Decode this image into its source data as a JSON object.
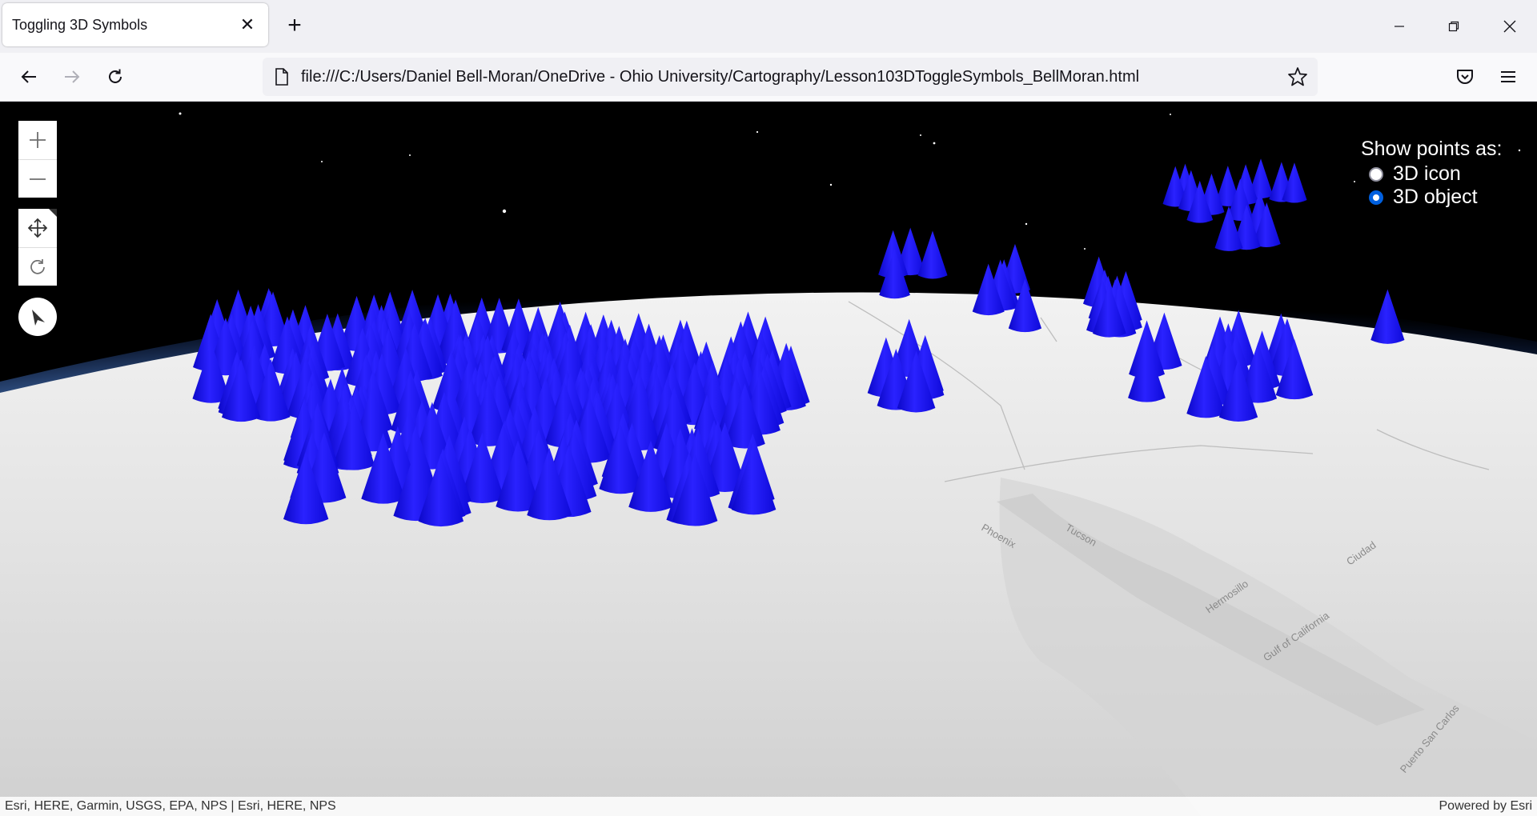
{
  "tab": {
    "title": "Toggling 3D Symbols",
    "close_glyph": "✕"
  },
  "newtab_glyph": "+",
  "nav": {
    "url": "file:///C:/Users/Daniel Bell-Moran/OneDrive - Ohio University/Cartography/Lesson103DToggleSymbols_BellMoran.html"
  },
  "map": {
    "toggle": {
      "title": "Show points as:",
      "options": [
        {
          "label": "3D icon",
          "checked": false
        },
        {
          "label": "3D object",
          "checked": true
        }
      ]
    },
    "place_labels": [
      "Phoenix",
      "Tucson",
      "Hermosillo",
      "Ciudad",
      "Gulf of California",
      "Puerto San Carlos"
    ],
    "attribution": "Esri, HERE, Garmin, USGS, EPA, NPS | Esri, HERE, NPS",
    "powered_by": "Powered by Esri",
    "colors": {
      "symbol": "#1a14ff",
      "space": "#000000",
      "basemap": "#d9d9d9",
      "accent": "#0060df"
    }
  }
}
